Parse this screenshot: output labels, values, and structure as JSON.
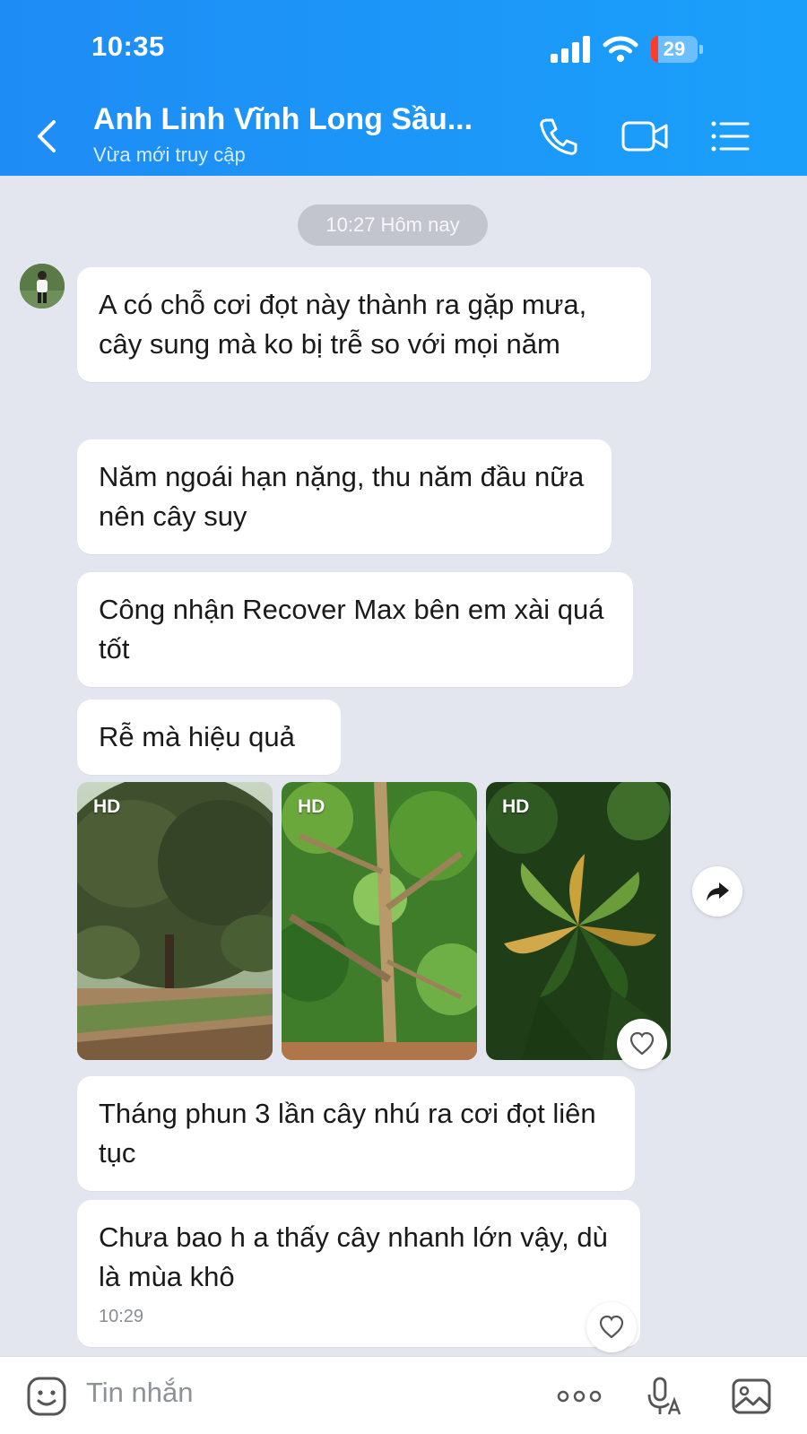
{
  "status_bar": {
    "time": "10:35",
    "battery": "29",
    "icons": [
      "signal-icon",
      "wifi-icon",
      "battery-icon"
    ]
  },
  "header": {
    "contact_name": "Anh Linh Vĩnh Long Sầu...",
    "contact_status": "Vừa mới truy cập",
    "icons": [
      "back-icon",
      "phone-icon",
      "video-call-icon",
      "menu-icon"
    ]
  },
  "chat": {
    "date_separator": "10:27 Hôm nay",
    "messages": [
      {
        "text": "A có chỗ cơi đọt này thành ra gặp mưa, cây sung mà ko bị trễ so với mọi năm"
      },
      {
        "text": "Năm ngoái hạn nặng, thu năm đầu nữa nên cây suy"
      },
      {
        "text": "Công nhận Recover Max bên em xài quá tốt"
      },
      {
        "text": "Rễ mà hiệu quả"
      },
      {
        "text": "Tháng phun 3 lần cây nhú ra cơi đọt liên tục"
      },
      {
        "text": "Chưa bao h a thấy cây nhanh lớn vậy, dù là mùa khô",
        "time": "10:29"
      }
    ],
    "photos": [
      {
        "badge": "HD",
        "subject": "orchard-trees"
      },
      {
        "badge": "HD",
        "subject": "tree-branches"
      },
      {
        "badge": "HD",
        "subject": "new-leaf-shoots"
      }
    ]
  },
  "input_bar": {
    "placeholder": "Tin nhắn",
    "icons": [
      "sticker-icon",
      "more-icon",
      "voice-to-text-icon",
      "image-icon"
    ]
  },
  "colors": {
    "header": "#1e8cf5",
    "chat_background": "#e3e6ee",
    "bubble": "#ffffff",
    "battery_low": "#ff3b30"
  }
}
